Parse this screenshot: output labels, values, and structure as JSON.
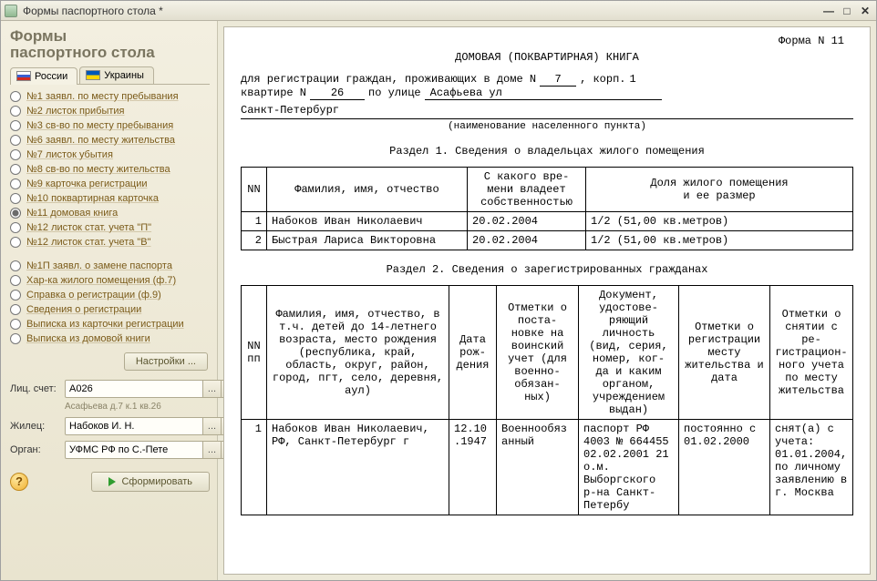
{
  "window": {
    "title": "Формы паспортного стола *"
  },
  "sidebar": {
    "heading_line1": "Формы",
    "heading_line2": "паспортного стола",
    "tabs": {
      "ru": "России",
      "ua": "Украины"
    },
    "group1": [
      "№1  заявл. по месту пребывания",
      "№2  листок прибытия",
      "№3  св-во по месту пребывания",
      "№6  заявл. по месту жительства",
      "№7  листок убытия",
      "№8  св-во по месту жительства",
      "№9  карточка регистрации",
      "№10 поквартирная карточка",
      "№11 домовая книга",
      "№12 листок стат. учета \"П\"",
      "№12 листок стат. учета \"В\""
    ],
    "selected1_index": 8,
    "group2": [
      "№1П  заявл. о замене паспорта",
      "Хар-ка жилого помещения (ф.7)",
      "Справка о регистрации (ф.9)",
      "Сведения о регистрации",
      "Выписка из карточки регистрации",
      "Выписка из домовой книги"
    ],
    "settings_btn": "Настройки ...",
    "labels": {
      "account": "Лиц. счет:",
      "resident": "Жилец:",
      "organ": "Орган:"
    },
    "fields": {
      "account": "А026",
      "account_note": "Асафьева д.7 к.1 кв.26",
      "resident": "Набоков И. Н.",
      "organ": "УФМС РФ по С.-Пете"
    },
    "generate_btn": "Сформировать"
  },
  "doc": {
    "form_no": "Форма N  11",
    "title": "ДОМОВАЯ (ПОКВАРТИРНАЯ) КНИГА",
    "reg_prefix": "для регистрации граждан, проживающих в доме N",
    "house_no": "7",
    "korp_label": ", корп.",
    "korp": "1",
    "flat_label": "квартире N",
    "flat": "26",
    "street_label": "по улице",
    "street": "Асафьева ул",
    "city": "Санкт-Петербург",
    "city_caption": "(наименование населенного пункта)",
    "section1": "Раздел 1. Сведения о владельцах жилого помещения",
    "t1": {
      "h_nn": "NN",
      "h_fio": "Фамилия, имя, отчество",
      "h_since": "С какого  вре-\nмени  владеет\nсобственностью",
      "h_share": "Доля жилого помещения\nи ее размер",
      "rows": [
        {
          "n": "1",
          "fio": "Набоков Иван Николаевич",
          "since": "20.02.2004",
          "share": "1/2  (51,00 кв.метров)"
        },
        {
          "n": "2",
          "fio": "Быстрая Лариса Викторовна",
          "since": "20.02.2004",
          "share": "1/2  (51,00 кв.метров)"
        }
      ]
    },
    "section2": "Раздел 2. Сведения о зарегистрированных гражданах",
    "t2": {
      "h_nn": "NN\nпп",
      "h_fio": "Фамилия, имя, отчество, в т.ч. детей до 14-летнего возраста, место рождения (республика, край, область, округ, район, город, пгт, село, деревня, аул)",
      "h_birth": "Дата рож-\nдения",
      "h_mil": "Отметки о поста-\nновке на воинский учет (для военно-\nобязан-\nных)",
      "h_doc": "Документ, удостове-\nряющий личность (вид, серия, номер, ког-\nда и каким органом, учреждением выдан)",
      "h_reg": "Отметки о регистрации месту жительства и дата",
      "h_off": "Отметки о снятии с ре-\nгистрацион-\nного учета по месту жительства",
      "rows": [
        {
          "n": "1",
          "fio": "Набоков Иван Николаевич, РФ, Санкт-Петербург г",
          "birth": "12.10\n.1947",
          "mil": "Военнообяз\nанный",
          "doc": "паспорт РФ 4003 № 664455 02.02.2001 21 о.м. Выборгского р-на Санкт-Петербу",
          "reg": "постоянно с 01.02.2000",
          "off": "снят(а) с учета: 01.01.2004, по личному заявлению в г. Москва"
        }
      ]
    }
  }
}
